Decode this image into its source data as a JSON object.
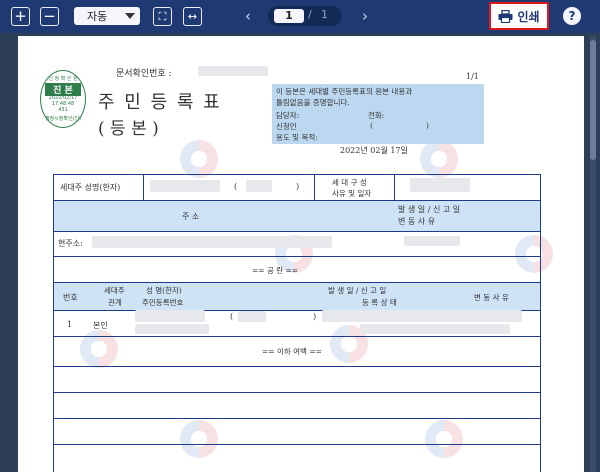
{
  "toolbar": {
    "zoom_in_glyph": "+",
    "zoom_out_glyph": "−",
    "zoom_value": "자동",
    "fit_page_glyph": "⛶",
    "fit_width_glyph": "↔",
    "prev_glyph": "‹",
    "next_glyph": "›",
    "current_page": "1",
    "page_separator": "/",
    "total_pages": "1",
    "print_label": "인쇄",
    "help_glyph": "?"
  },
  "document": {
    "doc_number_label": "문서확인번호 :",
    "page_count": "1/1",
    "title": "주 민 등 록 표",
    "subtitle": "( 등      본 )",
    "seal": {
      "top": "신 청 확 인 원",
      "main": "진 본",
      "date": "2022/02/17",
      "time": "17:48:48",
      "code": "431",
      "bottom": "행정시정확인(인)"
    },
    "certify_text_1": "이 등본은 세대별 주민등록표의 원본 내용과",
    "certify_text_2": "틀림없음을 증명합니다.",
    "manager_label": "담당자:",
    "phone_label": "전화:",
    "applicant_label": "신청인",
    "purpose_label": "용도 및 목적:",
    "issue_date": "2022년 02월 17일",
    "household": {
      "head_label": "세대주 성명(한자)",
      "composition_label_1": "세 대 구 성",
      "composition_label_2": "사유 및 일자"
    },
    "address_header": {
      "addr_label": "주                 소",
      "date_label": "발 생 일 / 신 고 일",
      "change_label": "변       동       사       유"
    },
    "current_address_label": "현주소:",
    "blank_row_text": "== 공       란 ==",
    "member_header": {
      "no": "번호",
      "relation_1": "세대주",
      "relation_2": "관계",
      "name_1": "성  명(한자)",
      "name_2": "주민등록번호",
      "date_1": "발 생 일 / 신 고 일",
      "date_2": "등 록 상 태",
      "change": "변 동 사 유"
    },
    "member_row": {
      "no": "1",
      "relation": "본인",
      "paren_open": "(",
      "paren_close": ")"
    },
    "end_text": "== 이하 여백 =="
  },
  "colors": {
    "toolbar_bg": "#1f3a73",
    "viewer_bg": "#2d3e57",
    "print_highlight": "#e0161c",
    "table_line": "#1e3a8a",
    "table_header_fill": "#cfe3f6"
  }
}
